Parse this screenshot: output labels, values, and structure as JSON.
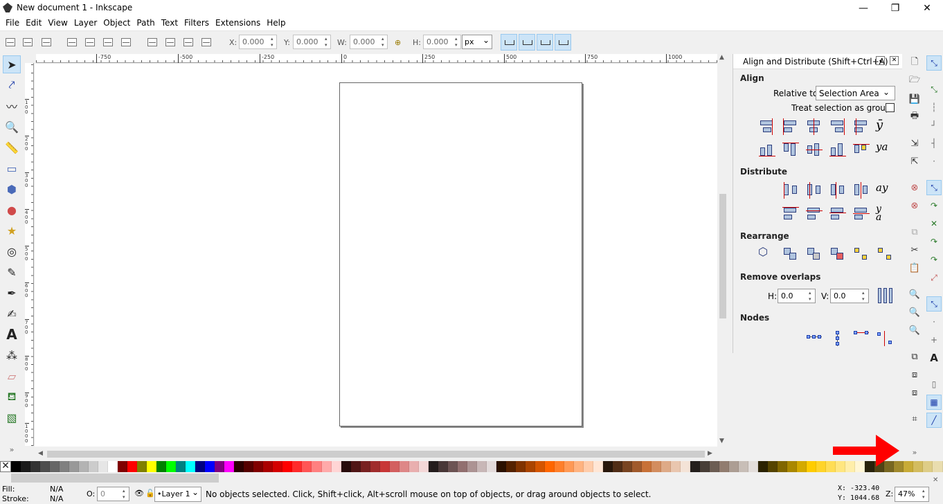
{
  "window": {
    "title": "New document 1 - Inkscape",
    "minimize": "—",
    "maximize": "❐",
    "close": "✕"
  },
  "menu": [
    "File",
    "Edit",
    "View",
    "Layer",
    "Object",
    "Path",
    "Text",
    "Filters",
    "Extensions",
    "Help"
  ],
  "controls": {
    "x_label": "X:",
    "x_value": "0.000",
    "y_label": "Y:",
    "y_value": "0.000",
    "w_label": "W:",
    "w_value": "0.000",
    "h_label": "H:",
    "h_value": "0.000",
    "unit": "px"
  },
  "tools": [
    "select",
    "node",
    "tweak",
    "zoom",
    "measure",
    "rect",
    "3dbox",
    "ellipse",
    "star",
    "spiral",
    "pencil",
    "pen",
    "calligraphy",
    "text",
    "spray",
    "eraser",
    "bucket",
    "gradient"
  ],
  "ruler_h": [
    "-750",
    "-500",
    "-250",
    "0",
    "250",
    "500",
    "750",
    "1000"
  ],
  "ruler_v": [
    "100",
    "200",
    "300",
    "400",
    "500",
    "600",
    "700",
    "800",
    "900",
    "1000"
  ],
  "dock": {
    "title": "Align and Distribute (Shift+Ctrl+A)",
    "align_heading": "Align",
    "relative_to_label": "Relative to:",
    "relative_to_value": "Selection Area",
    "treat_group_label": "Treat selection as group:",
    "distribute_heading": "Distribute",
    "rearrange_heading": "Rearrange",
    "remove_overlaps_heading": "Remove overlaps",
    "h_label": "H:",
    "h_value": "0.0",
    "v_label": "V:",
    "v_value": "0.0",
    "nodes_heading": "Nodes"
  },
  "palette": [
    "#000000",
    "#1a1a1a",
    "#333333",
    "#4d4d4d",
    "#666666",
    "#808080",
    "#999999",
    "#b3b3b3",
    "#cccccc",
    "#e6e6e6",
    "#ffffff",
    "#800000",
    "#ff0000",
    "#808000",
    "#ffff00",
    "#008000",
    "#00ff00",
    "#008080",
    "#00ffff",
    "#000080",
    "#0000ff",
    "#800080",
    "#ff00ff",
    "#2b0000",
    "#550000",
    "#800000",
    "#aa0000",
    "#d40000",
    "#ff0000",
    "#ff2a2a",
    "#ff5555",
    "#ff8080",
    "#ffaaaa",
    "#ffd5d5",
    "#280b0b",
    "#501616",
    "#782121",
    "#a02c2c",
    "#c83737",
    "#d35f5f",
    "#de8787",
    "#e9afaf",
    "#f4d7d7",
    "#241c1c",
    "#483737",
    "#6c5353",
    "#916f6f",
    "#ac9393",
    "#c8b7b7",
    "#e3dbdb",
    "#2b1100",
    "#552200",
    "#803300",
    "#aa4400",
    "#d45500",
    "#ff6600",
    "#ff7f2a",
    "#ff9955",
    "#ffb380",
    "#ffccaa",
    "#ffe6d5",
    "#28170b",
    "#502d16",
    "#784421",
    "#a05a2c",
    "#c87137",
    "#d38d5f",
    "#deaa87",
    "#e9c6af",
    "#f4e3d7",
    "#241f1c",
    "#483e37",
    "#6c5d53",
    "#917c6f",
    "#ac9d93",
    "#c8beb7",
    "#e3dedb",
    "#2b2200",
    "#554400",
    "#806600",
    "#aa8800",
    "#d4aa00",
    "#ffcc00",
    "#ffd42a",
    "#ffdd55",
    "#ffe680",
    "#ffeeaa",
    "#fff6d5",
    "#28220b",
    "#504416",
    "#786721",
    "#a0892c",
    "#c8ab37",
    "#d3bc5f",
    "#decd87",
    "#e9ddaf"
  ],
  "status": {
    "fill_label": "Fill:",
    "fill_value": "N/A",
    "stroke_label": "Stroke:",
    "stroke_value": "N/A",
    "opacity_label": "O:",
    "opacity_value": "0",
    "layer": "•Layer 1",
    "message": "No objects selected. Click, Shift+click, Alt+scroll mouse on top of objects, or drag around objects to select.",
    "x_coord": "X: -323.40",
    "y_coord": "Y: 1044.68",
    "zoom_label": "Z:",
    "zoom_value": "47%"
  },
  "colors": {
    "annotation_arrow": "#ff0000",
    "active_bg": "#cce4f7"
  }
}
